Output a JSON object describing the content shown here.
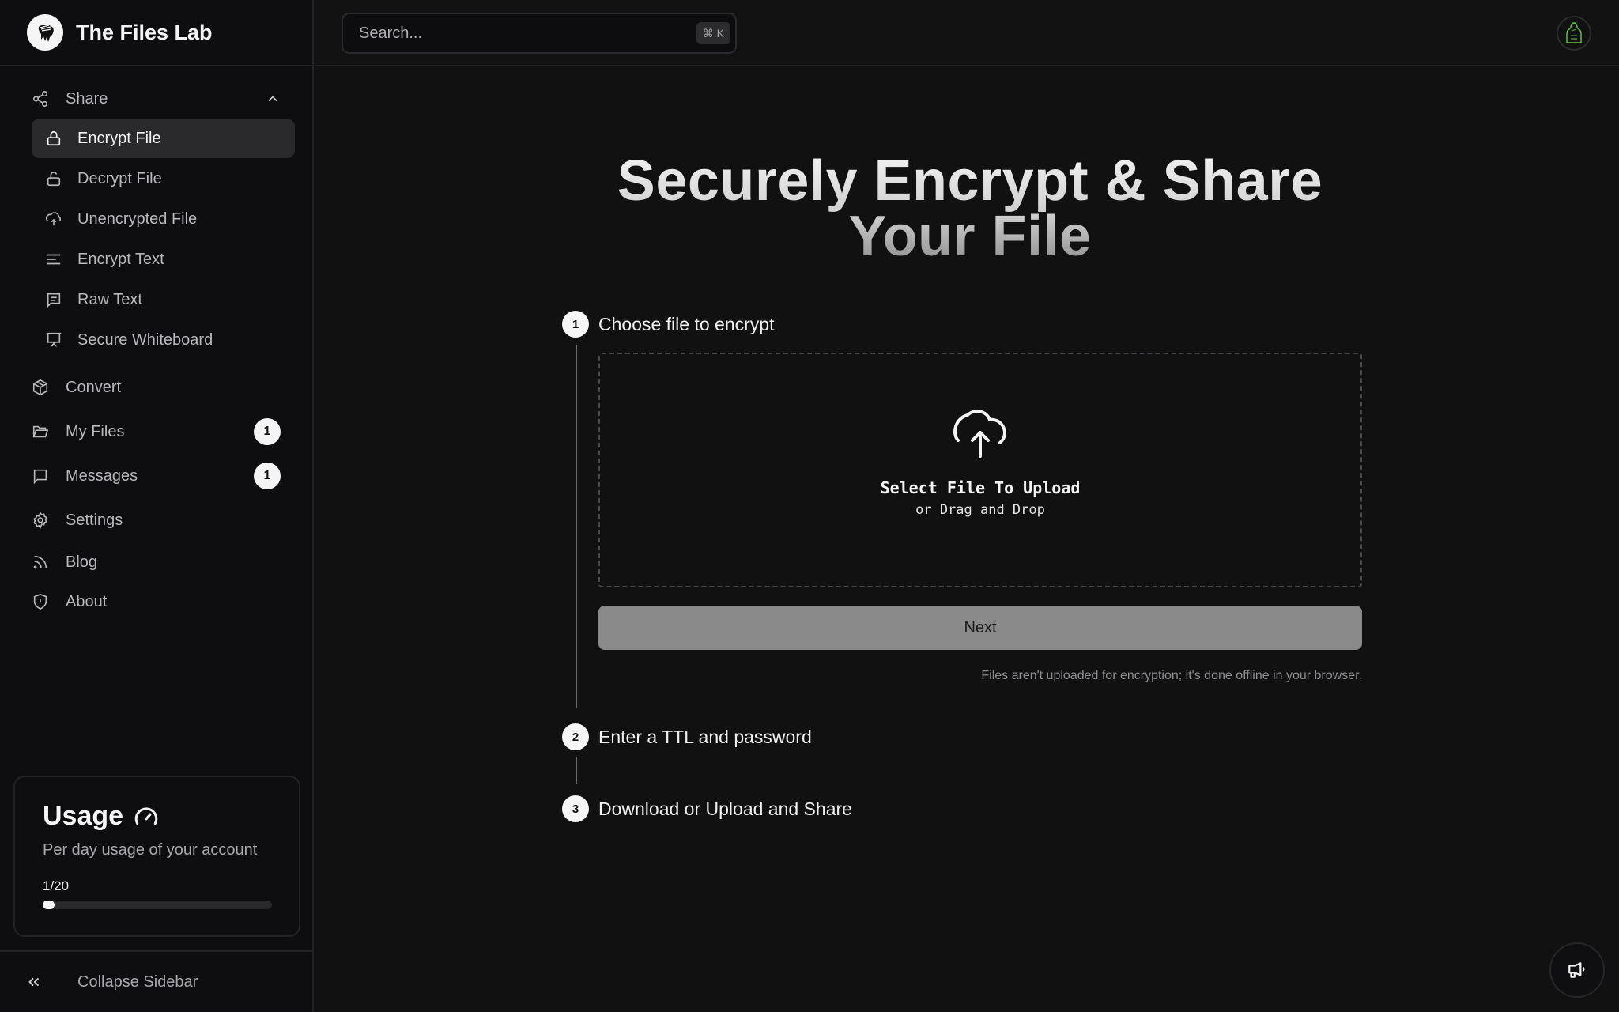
{
  "brand": {
    "name": "The Files Lab"
  },
  "search": {
    "placeholder": "Search...",
    "shortcut": "⌘ K"
  },
  "sidebar": {
    "share_group": {
      "label": "Share",
      "expanded": true,
      "items": [
        {
          "label": "Encrypt File",
          "icon": "lock-icon",
          "active": true
        },
        {
          "label": "Decrypt File",
          "icon": "unlock-icon",
          "active": false
        },
        {
          "label": "Unencrypted File",
          "icon": "cloud-upload-icon",
          "active": false
        },
        {
          "label": "Encrypt Text",
          "icon": "text-lines-icon",
          "active": false
        },
        {
          "label": "Raw Text",
          "icon": "message-square-text-icon",
          "active": false
        },
        {
          "label": "Secure Whiteboard",
          "icon": "presentation-icon",
          "active": false
        }
      ]
    },
    "items": [
      {
        "label": "Convert",
        "icon": "package-icon"
      },
      {
        "label": "My Files",
        "icon": "folder-open-icon",
        "badge": "1"
      },
      {
        "label": "Messages",
        "icon": "message-square-icon",
        "badge": "1"
      },
      {
        "label": "Settings",
        "icon": "gear-icon"
      },
      {
        "label": "Blog",
        "icon": "rss-icon"
      },
      {
        "label": "About",
        "icon": "shield-alert-icon"
      }
    ],
    "usage": {
      "title": "Usage",
      "subtitle": "Per day usage of your account",
      "count_label": "1/20",
      "used": 1,
      "limit": 20
    },
    "collapse_label": "Collapse Sidebar"
  },
  "main": {
    "hero_title": "Securely Encrypt & Share Your File",
    "steps": [
      {
        "number": "1",
        "title": "Choose file to encrypt"
      },
      {
        "number": "2",
        "title": "Enter a TTL and password"
      },
      {
        "number": "3",
        "title": "Download or Upload and Share"
      }
    ],
    "dropzone": {
      "title": "Select File To Upload",
      "subtitle": "or Drag and Drop"
    },
    "next_label": "Next",
    "note": "Files aren't uploaded for encryption; it's done offline in your browser."
  }
}
